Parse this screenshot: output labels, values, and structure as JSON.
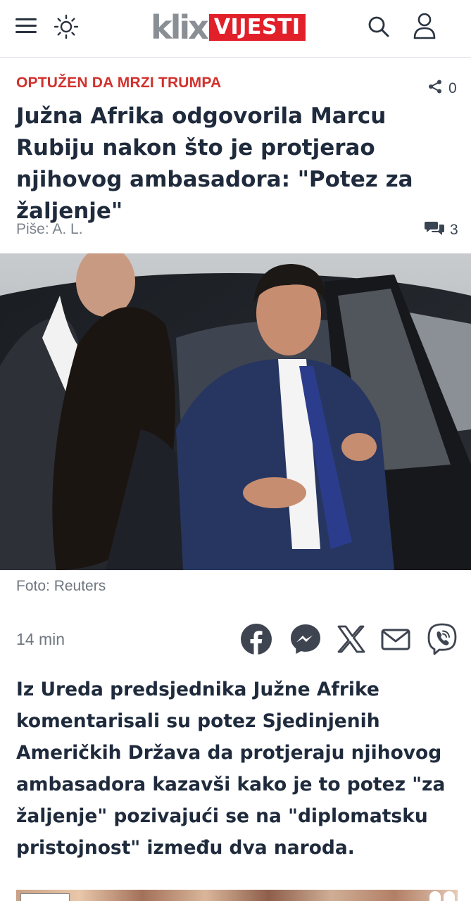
{
  "header": {
    "logo_klix": "klix",
    "logo_section": "VIJESTI",
    "logo_section_color": "#e2202a",
    "icons": [
      "menu-icon",
      "sun-icon",
      "search-icon",
      "user-icon"
    ]
  },
  "article": {
    "kicker": "OPTUŽEN DA MRZI TRUMPA",
    "kicker_color": "#d0312d",
    "share_count": "0",
    "headline": "Južna Afrika odgovorila Marcu Rubiju nakon što je protjerao njihovog ambasadora: \"Potez za žaljenje\"",
    "author": "Piše: A. L.",
    "comment_count": "3",
    "photo_caption": "Foto: Reuters",
    "time_ago": "14 min",
    "lead": "Iz Ureda predsjednika Južne Afrike komentarisali su potez Sjedinjenih Američkih Država da protjeraju njihovog ambasadora kazavši kako je to potez \"za žaljenje\" pozivajući se na \"diplomatsku pristojnost\" između dva naroda."
  },
  "share_buttons": [
    "facebook-icon",
    "messenger-icon",
    "x-icon",
    "email-icon",
    "viber-icon"
  ]
}
